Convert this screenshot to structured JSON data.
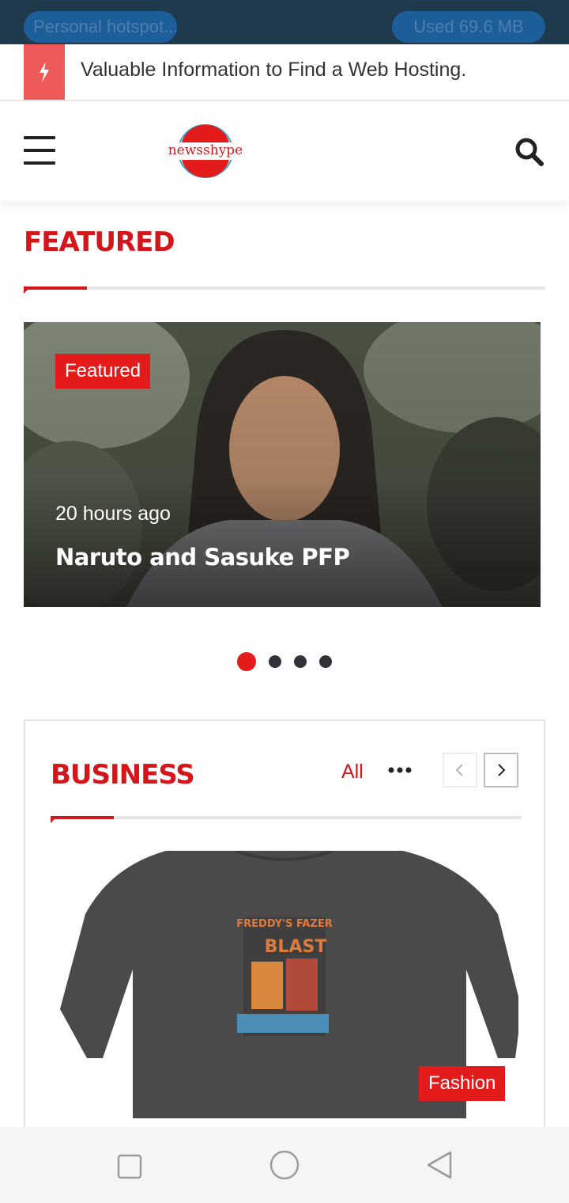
{
  "status_bar": {
    "hotspot_label": "Personal hotspot...",
    "usage_label": "Used  69.6 MB"
  },
  "ticker": {
    "icon": "lightning-icon",
    "text": "Valuable Information to Find a Web Hosting."
  },
  "header": {
    "menu_icon": "hamburger-menu-icon",
    "logo_text": "newsshype",
    "search_icon": "search-icon"
  },
  "featured": {
    "section_title": "FEATURED",
    "slide": {
      "badge": "Featured",
      "time": "20 hours ago",
      "headline": "Naruto and Sasuke PFP"
    },
    "slider_dots": {
      "count": 4,
      "active_index": 0
    }
  },
  "business": {
    "section_title": "BUSINESS",
    "all_link": "All",
    "more_icon": "more-dots-icon",
    "prev_icon": "chevron-left-icon",
    "next_icon": "chevron-right-icon",
    "card": {
      "badge": "Fashion",
      "shirt_print_title": "FREDDY'S FAZER",
      "shirt_print_word": "BLAST"
    }
  },
  "bottom_nav": {
    "recent_icon": "square-icon",
    "home_icon": "circle-icon",
    "back_icon": "triangle-back-icon"
  },
  "colors": {
    "accent": "#d4151a",
    "badge": "#e31b1b",
    "ticker_icon_bg": "#f0595a",
    "status_bar": "#1f3a4d"
  }
}
